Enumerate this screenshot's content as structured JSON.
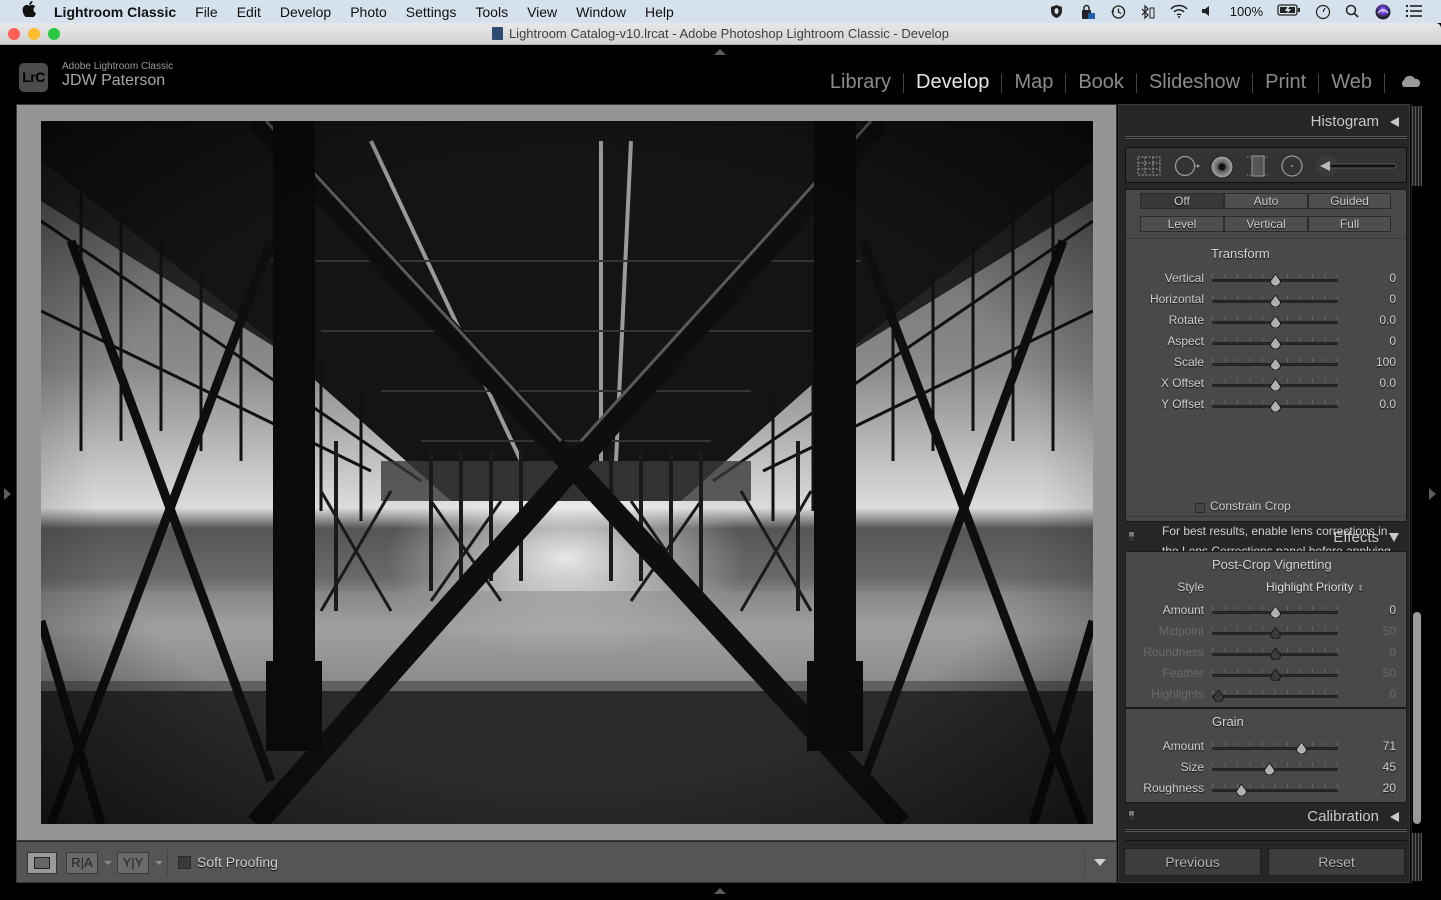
{
  "menubar": {
    "apple_icon": "apple-logo",
    "items": [
      "Lightroom Classic",
      "File",
      "Edit",
      "Develop",
      "Photo",
      "Settings",
      "Tools",
      "View",
      "Window",
      "Help"
    ],
    "status_icons": [
      "shield-icon",
      "lock-icon",
      "time-machine-icon",
      "bluetooth-icon",
      "wifi-icon",
      "volume-icon"
    ],
    "battery_text": "100%",
    "status_icons_right": [
      "clock-icon",
      "search-icon",
      "siri-icon",
      "list-icon"
    ]
  },
  "window": {
    "title": "Lightroom Catalog-v10.lrcat - Adobe Photoshop Lightroom Classic - Develop",
    "traffic_lights": {
      "close": "#ff5f57",
      "minimize": "#febc2e",
      "zoom": "#28c840"
    }
  },
  "header": {
    "logo_text": "LrC",
    "brand_sub": "Adobe Lightroom Classic",
    "brand_name": "JDW Paterson",
    "modules": [
      {
        "label": "Library",
        "active": false
      },
      {
        "label": "Develop",
        "active": true
      },
      {
        "label": "Map",
        "active": false
      },
      {
        "label": "Book",
        "active": false
      },
      {
        "label": "Slideshow",
        "active": false
      },
      {
        "label": "Print",
        "active": false
      },
      {
        "label": "Web",
        "active": false
      }
    ],
    "cloud_icon": "cloud-icon"
  },
  "photo": {
    "description": "Black and white photo under a pier with crossing iron beams on a beach"
  },
  "toolbar": {
    "view_buttons": [
      "loupe",
      "before-after RA",
      "before-after YY"
    ],
    "ra_label": "R|A",
    "yy_label": "Y|Y",
    "soft_proofing_label": "Soft Proofing",
    "soft_proofing_checked": false
  },
  "right_panel": {
    "histogram": {
      "title": "Histogram"
    },
    "tools": [
      "crop-overlay-icon",
      "spot-removal-icon",
      "red-eye-icon",
      "graduated-filter-icon",
      "radial-filter-icon",
      "adjustment-brush-icon"
    ],
    "upright": {
      "row1": [
        {
          "label": "Off",
          "active": true
        },
        {
          "label": "Auto",
          "active": false
        },
        {
          "label": "Guided",
          "active": false
        }
      ],
      "row2": [
        {
          "label": "Level",
          "active": false
        },
        {
          "label": "Vertical",
          "active": false
        },
        {
          "label": "Full",
          "active": false
        }
      ]
    },
    "transform": {
      "title": "Transform",
      "sliders": [
        {
          "label": "Vertical",
          "value": "0",
          "pos": 0.5
        },
        {
          "label": "Horizontal",
          "value": "0",
          "pos": 0.5
        },
        {
          "label": "Rotate",
          "value": "0.0",
          "pos": 0.5
        },
        {
          "label": "Aspect",
          "value": "0",
          "pos": 0.5
        },
        {
          "label": "Scale",
          "value": "100",
          "pos": 0.5
        },
        {
          "label": "X Offset",
          "value": "0.0",
          "pos": 0.5
        },
        {
          "label": "Y Offset",
          "value": "0.0",
          "pos": 0.5
        }
      ],
      "constrain_crop_label": "Constrain Crop",
      "constrain_crop_checked": false,
      "note": "For best results, enable lens corrections in the Lens Corrections panel before applying Upright."
    },
    "effects": {
      "title": "Effects",
      "vignette_title": "Post-Crop Vignetting",
      "style_label": "Style",
      "style_value": "Highlight Priority",
      "vignette_sliders": [
        {
          "label": "Amount",
          "value": "0",
          "pos": 0.5,
          "dim": false
        },
        {
          "label": "Midpoint",
          "value": "50",
          "pos": 0.5,
          "dim": true
        },
        {
          "label": "Roundness",
          "value": "0",
          "pos": 0.5,
          "dim": true
        },
        {
          "label": "Feather",
          "value": "50",
          "pos": 0.5,
          "dim": true
        },
        {
          "label": "Highlights",
          "value": "0",
          "pos": 0.05,
          "dim": true
        }
      ],
      "grain_title": "Grain",
      "grain_sliders": [
        {
          "label": "Amount",
          "value": "71",
          "pos": 0.71
        },
        {
          "label": "Size",
          "value": "45",
          "pos": 0.45
        },
        {
          "label": "Roughness",
          "value": "20",
          "pos": 0.23
        }
      ]
    },
    "calibration": {
      "title": "Calibration"
    },
    "previous_label": "Previous",
    "reset_label": "Reset"
  }
}
